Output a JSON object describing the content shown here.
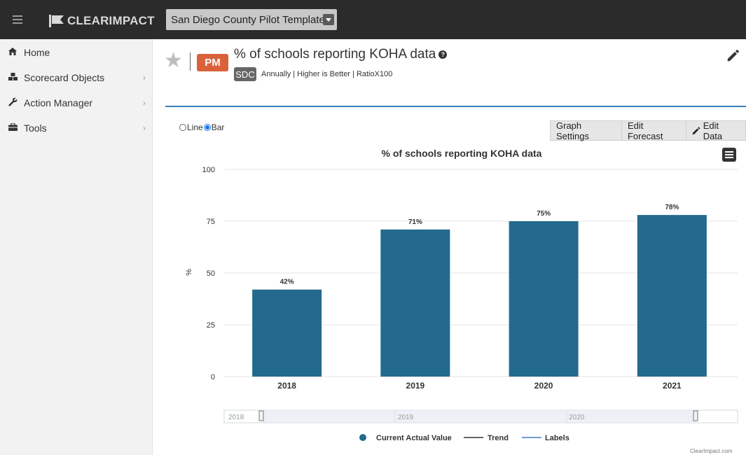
{
  "app": {
    "logo_text": "CLEARIMPACT",
    "template_name": "San Diego County Pilot Template"
  },
  "sidebar": {
    "items": [
      {
        "label": "Home",
        "icon": "home-icon"
      },
      {
        "label": "Scorecard Objects",
        "icon": "cubes-icon"
      },
      {
        "label": "Action Manager",
        "icon": "wrench-icon"
      },
      {
        "label": "Tools",
        "icon": "briefcase-icon"
      }
    ]
  },
  "header": {
    "badge": "PM",
    "title": "% of schools reporting KOHA data",
    "scorecard_badge": "SDC",
    "subtitle": "Annually | Higher is Better | RatioX100"
  },
  "controls": {
    "line_label": "Line",
    "bar_label": "Bar",
    "selected": "Bar",
    "buttons": [
      "Graph Settings",
      "Edit Forecast",
      "Edit Data"
    ]
  },
  "chart_data": {
    "type": "bar",
    "title": "% of schools reporting KOHA data",
    "ylabel": "%",
    "categories": [
      "2018",
      "2019",
      "2020",
      "2021"
    ],
    "series": [
      {
        "name": "Current Actual Value",
        "values": [
          42,
          71,
          75,
          78
        ],
        "color": "#236a8e"
      }
    ],
    "data_labels": [
      "42%",
      "71%",
      "75%",
      "78%"
    ],
    "ylim": [
      0,
      100
    ],
    "yticks": [
      0,
      25,
      50,
      75,
      100
    ],
    "navigator_labels": [
      "2018",
      "2019",
      "2020"
    ],
    "legend": [
      {
        "label": "Current Actual Value",
        "kind": "dot"
      },
      {
        "label": "Trend",
        "kind": "line-dark"
      },
      {
        "label": "Labels",
        "kind": "line-blue"
      }
    ],
    "credit": "ClearImpact.com",
    "legend_position": "bottom"
  }
}
